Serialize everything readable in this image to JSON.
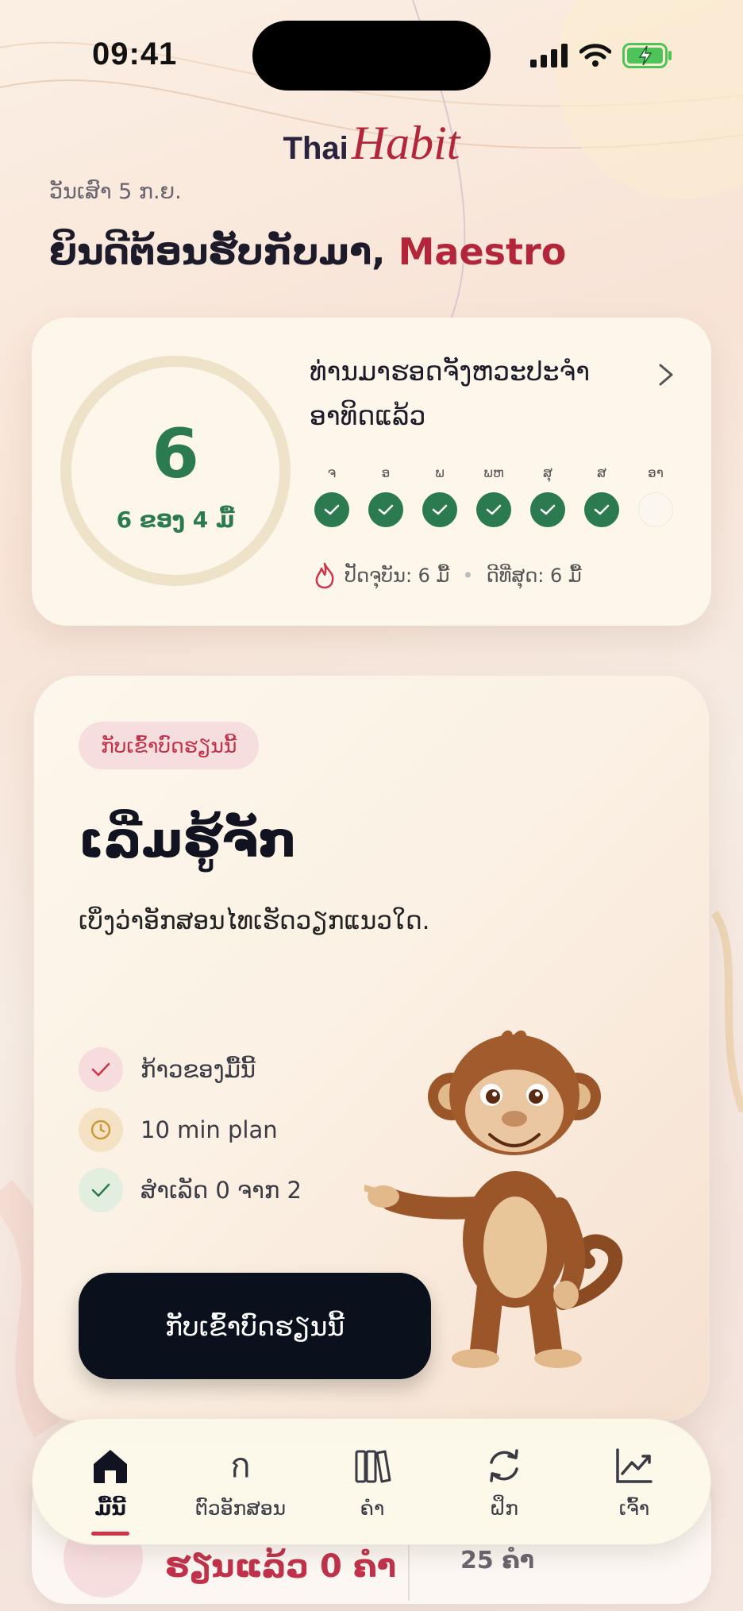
{
  "status_bar": {
    "time": "09:41"
  },
  "header": {
    "brand_thai": "Thai",
    "brand_habit": "Habit",
    "date": "ວັນເສົາ 5 ກ.ຍ.",
    "welcome_prefix": "ຍິນດີຕ້ອນຮັບກັບມາ,",
    "welcome_name": "Maestro"
  },
  "streak": {
    "count": "6",
    "sub_label": "6 ຂອງ 4 ມື້",
    "title": "ທ່ານມາຮອດຈັງຫວະປະຈຳອາທິດແລ້ວ",
    "days": [
      {
        "label": "ຈ",
        "done": true
      },
      {
        "label": "ອ",
        "done": true
      },
      {
        "label": "ພ",
        "done": true
      },
      {
        "label": "ພຫ",
        "done": true
      },
      {
        "label": "ສຸ",
        "done": true
      },
      {
        "label": "ສ",
        "done": true
      },
      {
        "label": "ອາ",
        "done": false
      }
    ],
    "current_label": "ປັດຈຸບັນ: 6 ມື້",
    "best_label": "ດີທີ່ສຸດ: 6 ມື້",
    "accent_color": "#2c7a50"
  },
  "lesson": {
    "badge": "ກັບເຂົ້າບົດຮຽນນີ້",
    "title": "ເລີ່ມຮູ້ຈັກ",
    "description": "ເບິ່ງວ່າອັກສອນໄທເຮັດວຽກແນວໃດ.",
    "info": [
      {
        "icon": "check-icon",
        "text": "ກ້າວຂອງມື້ນີ້",
        "color": "#d0344b"
      },
      {
        "icon": "clock-icon",
        "text": "10 min plan",
        "color": "#c99b3a"
      },
      {
        "icon": "check-icon",
        "text": "ສຳເລັດ 0 ຈາກ 2",
        "color": "#2c7a50"
      }
    ],
    "cta_label": "ກັບເຂົ້າບົດຮຽນນີ້"
  },
  "peek": {
    "text": "ຮຽນແລ້ວ 0 ຄຳ",
    "text2": "25 ຄຳ"
  },
  "nav": {
    "items": [
      {
        "label": "ມື້ນີ້",
        "icon": "home-icon",
        "active": true
      },
      {
        "label": "ຕົວອັກສອນ",
        "icon": "thai-letter-icon",
        "glyph": "ก",
        "active": false
      },
      {
        "label": "ຄຳ",
        "icon": "books-icon",
        "active": false
      },
      {
        "label": "ຝຶກ",
        "icon": "refresh-icon",
        "active": false
      },
      {
        "label": "ເຈົ້າ",
        "icon": "chart-icon",
        "active": false
      }
    ]
  },
  "colors": {
    "brand_red": "#b3263a",
    "dark_button": "#0a111c"
  }
}
